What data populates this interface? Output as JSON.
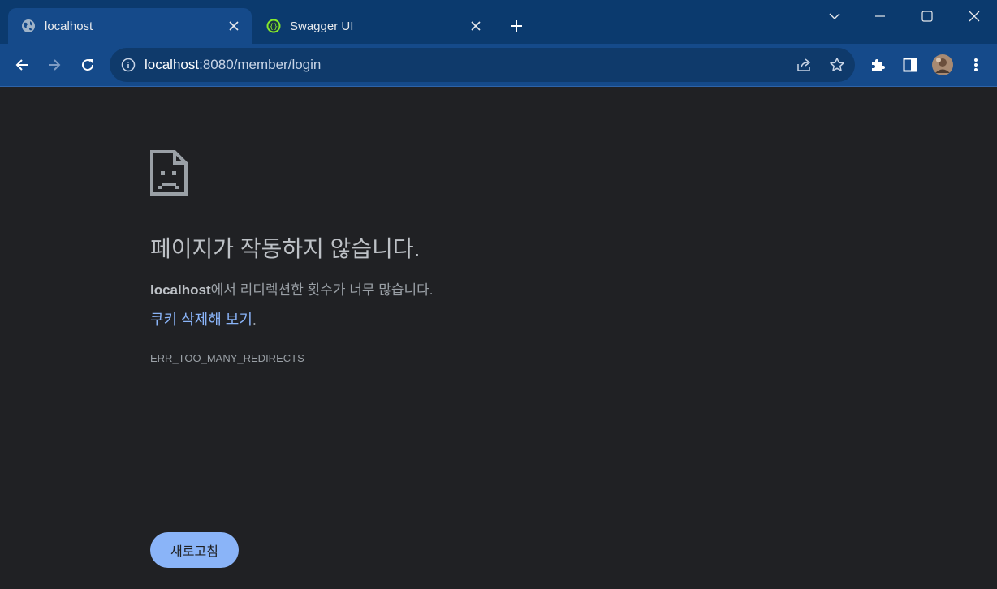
{
  "tabs": [
    {
      "title": "localhost",
      "icon": "globe-icon",
      "active": true
    },
    {
      "title": "Swagger UI",
      "icon": "swagger-icon",
      "active": false
    }
  ],
  "address_bar": {
    "host": "localhost",
    "path": ":8080/member/login"
  },
  "error_page": {
    "heading": "페이지가 작동하지 않습니다.",
    "host": "localhost",
    "message": "에서 리디렉션한 횟수가 너무 많습니다.",
    "suggestion_link": "쿠키 삭제해 보기",
    "suggestion_end": ".",
    "error_code": "ERR_TOO_MANY_REDIRECTS",
    "reload_button": "새로고침"
  },
  "colors": {
    "titlebar": "#0b3a6e",
    "toolbar": "#154a8a",
    "page_background": "#202124",
    "link": "#8ab4f8",
    "button": "#8ab4f8",
    "swagger_green": "#85ea2d"
  }
}
